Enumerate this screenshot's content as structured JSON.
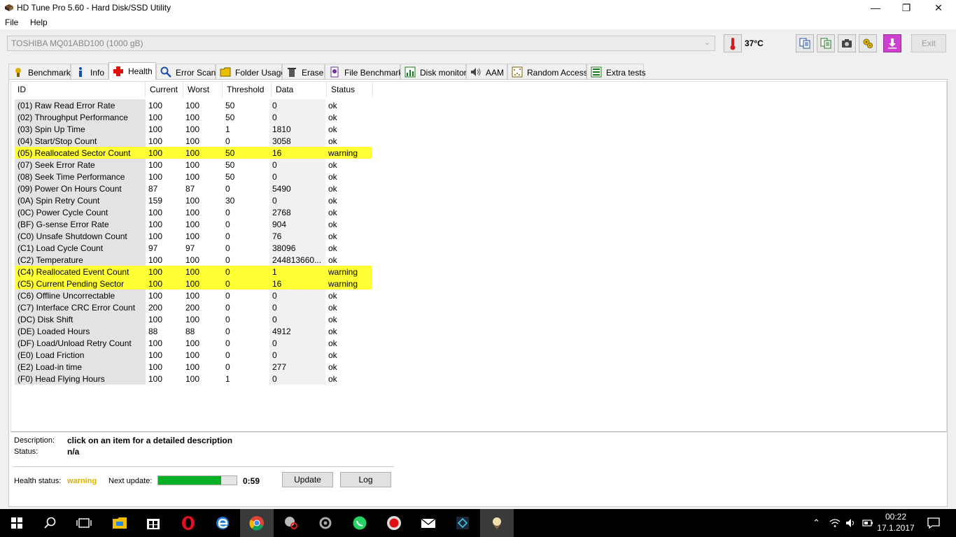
{
  "window": {
    "title": "HD Tune Pro 5.60 - Hard Disk/SSD Utility",
    "minimize": "—",
    "maximize": "❐",
    "close": "✕"
  },
  "menu": {
    "file": "File",
    "help": "Help"
  },
  "toolbar": {
    "drive": "TOSHIBA MQ01ABD100 (1000 gB)",
    "temperature": "37°C",
    "buttons": [
      "copy-info-icon",
      "copy-info-alt-icon",
      "screenshot-icon",
      "options-icon",
      "save-icon"
    ],
    "exit": "Exit"
  },
  "tabs": [
    {
      "label": "Benchmark",
      "icon": "benchmark-icon",
      "active": false
    },
    {
      "label": "Info",
      "icon": "info-icon",
      "active": false
    },
    {
      "label": "Health",
      "icon": "health-icon",
      "active": true
    },
    {
      "label": "Error Scan",
      "icon": "error-scan-icon",
      "active": false
    },
    {
      "label": "Folder Usage",
      "icon": "folder-usage-icon",
      "active": false
    },
    {
      "label": "Erase",
      "icon": "erase-icon",
      "active": false
    },
    {
      "label": "File Benchmark",
      "icon": "file-benchmark-icon",
      "active": false
    },
    {
      "label": "Disk monitor",
      "icon": "disk-monitor-icon",
      "active": false
    },
    {
      "label": "AAM",
      "icon": "aam-icon",
      "active": false
    },
    {
      "label": "Random Access",
      "icon": "random-access-icon",
      "active": false
    },
    {
      "label": "Extra tests",
      "icon": "extra-tests-icon",
      "active": false
    }
  ],
  "columns": [
    "ID",
    "Current",
    "Worst",
    "Threshold",
    "Data",
    "Status"
  ],
  "rows": [
    [
      "(01) Raw Read Error Rate",
      "100",
      "100",
      "50",
      "0",
      "ok"
    ],
    [
      "(02) Throughput Performance",
      "100",
      "100",
      "50",
      "0",
      "ok"
    ],
    [
      "(03) Spin Up Time",
      "100",
      "100",
      "1",
      "1810",
      "ok"
    ],
    [
      "(04) Start/Stop Count",
      "100",
      "100",
      "0",
      "3058",
      "ok"
    ],
    [
      "(05) Reallocated Sector Count",
      "100",
      "100",
      "50",
      "16",
      "warning"
    ],
    [
      "(07) Seek Error Rate",
      "100",
      "100",
      "50",
      "0",
      "ok"
    ],
    [
      "(08) Seek Time Performance",
      "100",
      "100",
      "50",
      "0",
      "ok"
    ],
    [
      "(09) Power On Hours Count",
      "87",
      "87",
      "0",
      "5490",
      "ok"
    ],
    [
      "(0A) Spin Retry Count",
      "159",
      "100",
      "30",
      "0",
      "ok"
    ],
    [
      "(0C) Power Cycle Count",
      "100",
      "100",
      "0",
      "2768",
      "ok"
    ],
    [
      "(BF) G-sense Error Rate",
      "100",
      "100",
      "0",
      "904",
      "ok"
    ],
    [
      "(C0) Unsafe Shutdown Count",
      "100",
      "100",
      "0",
      "76",
      "ok"
    ],
    [
      "(C1) Load Cycle Count",
      "97",
      "97",
      "0",
      "38096",
      "ok"
    ],
    [
      "(C2) Temperature",
      "100",
      "100",
      "0",
      "244813660...",
      "ok"
    ],
    [
      "(C4) Reallocated Event Count",
      "100",
      "100",
      "0",
      "1",
      "warning"
    ],
    [
      "(C5) Current Pending Sector",
      "100",
      "100",
      "0",
      "16",
      "warning"
    ],
    [
      "(C6) Offline Uncorrectable",
      "100",
      "100",
      "0",
      "0",
      "ok"
    ],
    [
      "(C7) Interface CRC Error Count",
      "200",
      "200",
      "0",
      "0",
      "ok"
    ],
    [
      "(DC) Disk Shift",
      "100",
      "100",
      "0",
      "0",
      "ok"
    ],
    [
      "(DE) Loaded Hours",
      "88",
      "88",
      "0",
      "4912",
      "ok"
    ],
    [
      "(DF) Load/Unload Retry Count",
      "100",
      "100",
      "0",
      "0",
      "ok"
    ],
    [
      "(E0) Load Friction",
      "100",
      "100",
      "0",
      "0",
      "ok"
    ],
    [
      "(E2) Load-in time",
      "100",
      "100",
      "0",
      "277",
      "ok"
    ],
    [
      "(F0) Head Flying Hours",
      "100",
      "100",
      "1",
      "0",
      "ok"
    ]
  ],
  "details": {
    "description_label": "Description:",
    "description": "click on an item for a detailed description",
    "status_label": "Status:",
    "status": "n/a"
  },
  "footer": {
    "health_status_label": "Health status:",
    "health_status": "warning",
    "next_update_label": "Next update:",
    "progress_fraction": 0.8,
    "countdown": "0:59",
    "update": "Update",
    "log": "Log"
  },
  "taskbar": {
    "apps": [
      "windows-start-icon",
      "search-icon",
      "task-view-icon",
      "file-explorer-icon",
      "store-icon",
      "opera-icon",
      "edge-icon",
      "chrome-icon",
      "snipping-icon",
      "app-icon",
      "whatsapp-icon",
      "record-icon",
      "mail-icon",
      "remote-icon",
      "hdtune-icon"
    ],
    "time": "00:22",
    "date": "17.1.2017"
  },
  "colors": {
    "warning_row": "#ffff33",
    "warning_text": "#e0b000",
    "progress": "#06b025",
    "accent": "#0078d7"
  }
}
